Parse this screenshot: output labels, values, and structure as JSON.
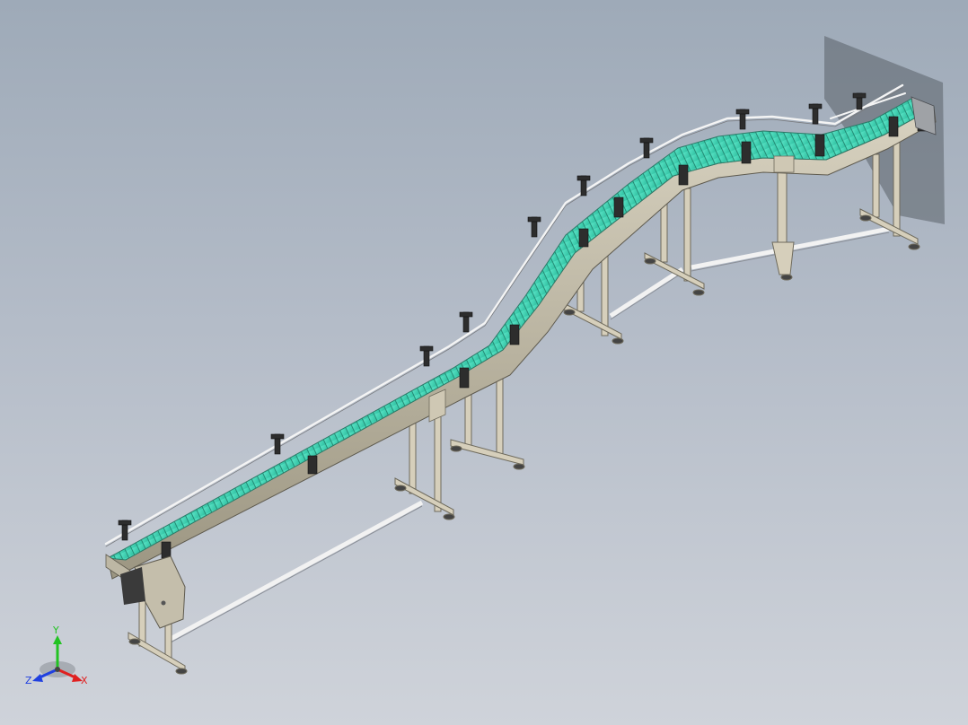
{
  "viewport": {
    "background_top": "#9eaab8",
    "background_bottom": "#cfd3da"
  },
  "model": {
    "belt_color": "#3fd8b8",
    "frame_color": "#c8c2b0",
    "guide_rail_color": "#e2e2e2"
  },
  "triad": {
    "y_label": "Y",
    "x_label": "X",
    "z_label": "Z",
    "y_color": "#22c322",
    "x_color": "#e02020",
    "z_color": "#2040e0"
  }
}
